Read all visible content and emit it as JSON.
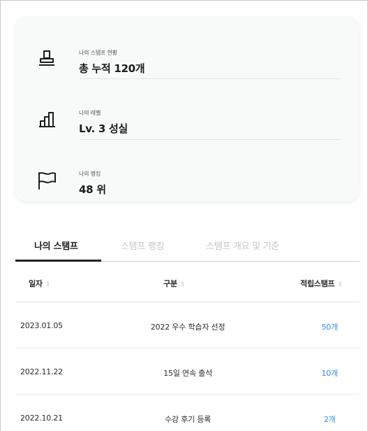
{
  "summary": {
    "stamp": {
      "label": "나의 스탬프 현황",
      "value": "총 누적 120개",
      "icon": "stamp-icon"
    },
    "level": {
      "label": "나의 레벨",
      "value": "Lv. 3 성실",
      "icon": "bar-chart-icon"
    },
    "ranking": {
      "label": "나의 랭킹",
      "value": "48 위",
      "icon": "flag-icon"
    }
  },
  "tabs": [
    {
      "label": "나의 스탬프",
      "active": true
    },
    {
      "label": "스탬프 랭킹",
      "active": false
    },
    {
      "label": "스탬프 개요 및 기준",
      "active": false
    }
  ],
  "table": {
    "headers": {
      "date": "일자",
      "category": "구분",
      "stamps": "적립스탬프",
      "sort_glyph": "⇕"
    },
    "rows": [
      {
        "date": "2023.01.05",
        "category": "2022 우수 학습자 선정",
        "stamps": "50개"
      },
      {
        "date": "2022.11.22",
        "category": "15일 연속 출석",
        "stamps": "10개"
      },
      {
        "date": "2022.10.21",
        "category": "수강 후기 등록",
        "stamps": "2개"
      }
    ]
  },
  "colors": {
    "accent": "#2f8ee8",
    "card_bg": "#f8fafa",
    "tab_inactive": "#c4c4c4"
  }
}
